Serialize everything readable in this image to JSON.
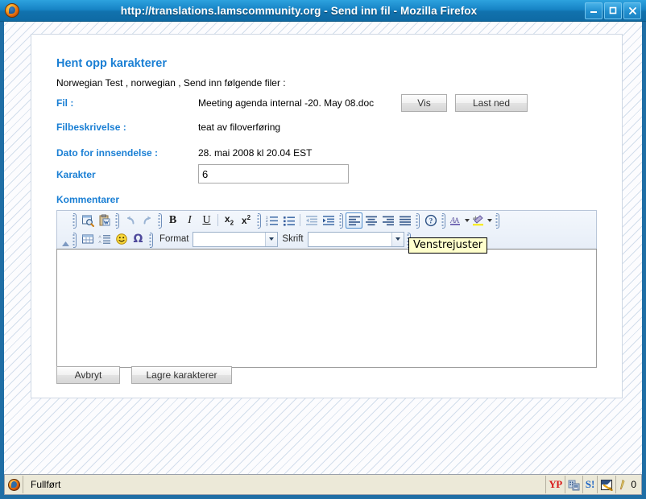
{
  "window": {
    "title": "http://translations.lamscommunity.org - Send inn fil - Mozilla Firefox",
    "app_icon": "firefox-logo-icon",
    "controls": {
      "minimize": "minimize-icon",
      "maximize": "maximize-icon",
      "close": "close-icon"
    }
  },
  "page": {
    "title": "Hent opp karakterer",
    "intro": "Norwegian Test , norwegian , Send inn følgende filer :",
    "fields": [
      {
        "label": "Fil :",
        "value": "Meeting agenda internal -20. May 08.doc"
      },
      {
        "label": "Filbeskrivelse :",
        "value": "teat av filoverføring"
      },
      {
        "label": "Dato for innsendelse :",
        "value": "28. mai 2008 kl 20.04 EST"
      }
    ],
    "grade": {
      "label": "Karakter",
      "value": "6"
    },
    "comments_label": "Kommentarer",
    "file_buttons": {
      "view": "Vis",
      "download": "Last ned"
    },
    "actions": {
      "cancel": "Avbryt",
      "save": "Lagre karakterer"
    }
  },
  "editor": {
    "toolbar_row1": [
      {
        "name": "preview-icon",
        "title": "Forhåndsvis"
      },
      {
        "name": "paste-word-icon",
        "title": "Lim inn fra Word"
      },
      {
        "name": "undo-icon",
        "title": "Angre"
      },
      {
        "name": "redo-icon",
        "title": "Gjør om"
      },
      {
        "name": "bold-icon",
        "title": "Fet",
        "glyph": "B"
      },
      {
        "name": "italic-icon",
        "title": "Kursiv",
        "glyph": "I"
      },
      {
        "name": "underline-icon",
        "title": "Understrek",
        "glyph": "U"
      },
      {
        "name": "subscript-icon",
        "title": "Senket skrift"
      },
      {
        "name": "superscript-icon",
        "title": "Hevet skrift"
      },
      {
        "name": "ordered-list-icon",
        "title": "Nummerert liste"
      },
      {
        "name": "unordered-list-icon",
        "title": "Punktliste"
      },
      {
        "name": "outdent-icon",
        "title": "Reduser innrykk"
      },
      {
        "name": "indent-icon",
        "title": "Øk innrykk"
      },
      {
        "name": "align-left-icon",
        "title": "Venstrejuster",
        "active": true
      },
      {
        "name": "align-center-icon",
        "title": "Midtstill"
      },
      {
        "name": "align-right-icon",
        "title": "Høyrejuster"
      },
      {
        "name": "align-justify-icon",
        "title": "Blokkjuster"
      },
      {
        "name": "help-icon",
        "title": "Hjelp"
      },
      {
        "name": "text-color-icon",
        "title": "Tekstfarge"
      },
      {
        "name": "highlight-color-icon",
        "title": "Bakgrunnsfarge"
      }
    ],
    "toolbar_row2": [
      {
        "name": "insert-table-icon",
        "title": "Sett inn tabell"
      },
      {
        "name": "definition-list-icon",
        "title": "Definisjonsliste"
      },
      {
        "name": "smiley-icon",
        "title": "Sett inn smilefjes"
      },
      {
        "name": "special-char-icon",
        "title": "Sett inn spesialtegn",
        "glyph": "Ω"
      }
    ],
    "format_label": "Format",
    "format_value": "",
    "font_label": "Skrift",
    "font_value": "",
    "content": "",
    "tooltip": "Venstrejuster"
  },
  "statusbar": {
    "text": "Fullført",
    "tray": [
      {
        "name": "yahoo-pops-icon",
        "label": "YP"
      },
      {
        "name": "network-icon",
        "label": ""
      },
      {
        "name": "skype-icon",
        "label": "S!"
      },
      {
        "name": "ads-blocker-icon",
        "label": ""
      },
      {
        "name": "pencil-icon",
        "label": ""
      }
    ],
    "count": "0"
  },
  "colors": {
    "titlebar": "#1784c6",
    "accent_blue": "#1a7fd4",
    "page_bg": "#e8eef6",
    "status_bg": "#ece9d8"
  }
}
